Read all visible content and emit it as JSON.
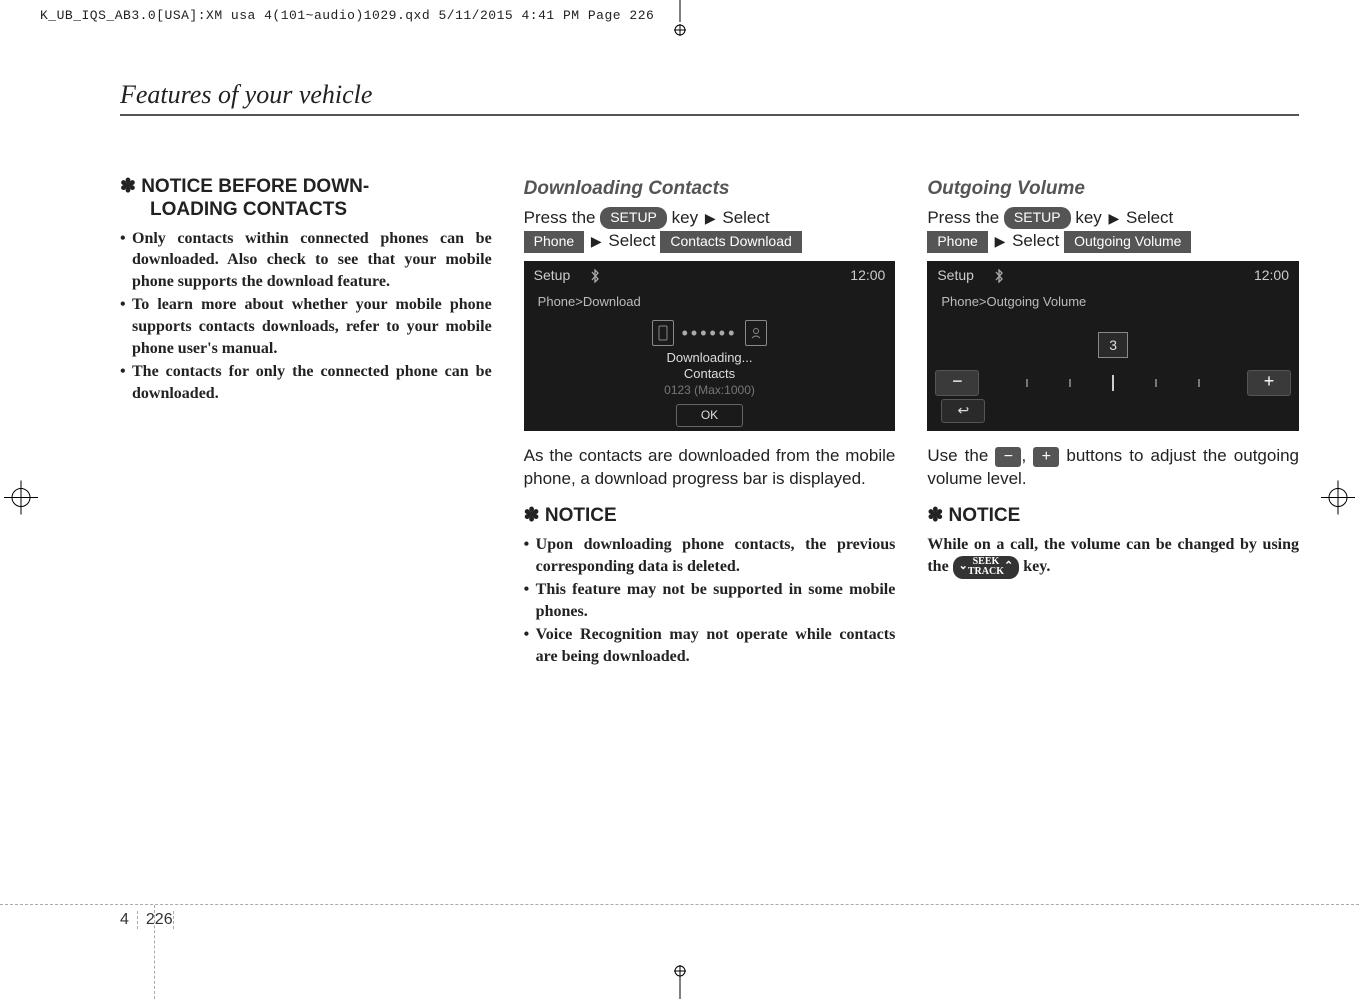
{
  "file_header": "K_UB_IQS_AB3.0[USA]:XM usa 4(101~audio)1029.qxd  5/11/2015  4:41 PM  Page 226",
  "section_title": "Features of your vehicle",
  "page": {
    "chapter": "4",
    "number": "226"
  },
  "col1": {
    "notice_head_line1": "✽ NOTICE BEFORE DOWN-",
    "notice_head_line2": "LOADING CONTACTS",
    "bullets": [
      "Only contacts within connected phones can be downloaded. Also check to see that your mobile phone supports the download feature.",
      "To learn more about whether your mobile phone supports contacts downloads, refer to your mobile phone user's manual.",
      "The contacts for only the connected phone can be downloaded."
    ]
  },
  "col2": {
    "sub_head": "Downloading Contacts",
    "instr_press": "Press the",
    "key_setup": "SETUP",
    "instr_key": "key",
    "instr_select": "Select",
    "key_phone": "Phone",
    "key_select_word": "Select",
    "key_contacts_dl": "Contacts Download",
    "screenshot": {
      "title": "Setup",
      "breadcrumb": "Phone>Download",
      "time": "12:00",
      "dl_text1": "Downloading...",
      "dl_text2": "Contacts",
      "dl_sub": "0123 (Max:1000)",
      "ok": "OK"
    },
    "body": "As the contacts are downloaded from the mobile phone, a download progress bar is displayed.",
    "notice_head": "✽ NOTICE",
    "bullets": [
      "Upon downloading phone contacts, the previous corresponding data is deleted.",
      "This feature may not be supported in some mobile phones.",
      "Voice Recognition may not operate while contacts are being downloaded."
    ]
  },
  "col3": {
    "sub_head": "Outgoing Volume",
    "instr_press": "Press the",
    "key_setup": "SETUP",
    "instr_key": "key",
    "instr_select": "Select",
    "key_phone": "Phone",
    "key_select_word": "Select",
    "key_outgoing": "Outgoing Volume",
    "screenshot": {
      "title": "Setup",
      "breadcrumb": "Phone>Outgoing Volume",
      "time": "12:00",
      "volume_value": "3",
      "minus": "−",
      "plus": "+",
      "back": "↩"
    },
    "body_pre": "Use the ",
    "body_mid": ", ",
    "body_post": " buttons to adjust the outgoing volume level.",
    "notice_head": "✽ NOTICE",
    "notice_body_pre": "While on a call, the volume can be changed by using the ",
    "seek_top": "SEEK",
    "seek_bot": "TRACK",
    "notice_body_post": " key."
  }
}
